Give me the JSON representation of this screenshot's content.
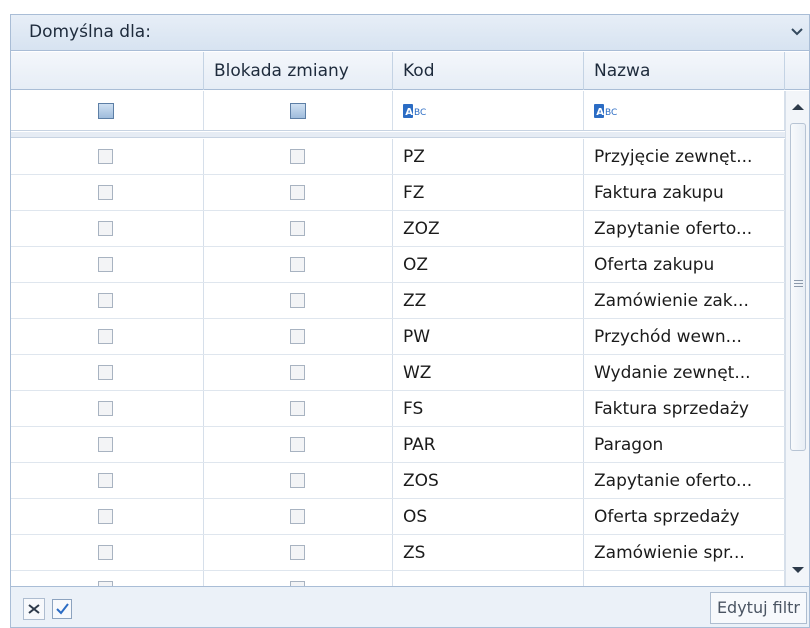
{
  "group": {
    "title": "Domyślna dla:"
  },
  "columns": {
    "col0": "",
    "col1": "Blokada zmiany",
    "col2": "Kod",
    "col3": "Nazwa"
  },
  "rows": [
    {
      "kod": "PZ",
      "nazwa": "Przyjęcie zewnęt..."
    },
    {
      "kod": "FZ",
      "nazwa": "Faktura zakupu"
    },
    {
      "kod": "ZOZ",
      "nazwa": "Zapytanie oferto..."
    },
    {
      "kod": "OZ",
      "nazwa": "Oferta zakupu"
    },
    {
      "kod": "ZZ",
      "nazwa": "Zamówienie zak..."
    },
    {
      "kod": "PW",
      "nazwa": "Przychód wewn..."
    },
    {
      "kod": "WZ",
      "nazwa": "Wydanie zewnęt..."
    },
    {
      "kod": "FS",
      "nazwa": "Faktura sprzedaży"
    },
    {
      "kod": "PAR",
      "nazwa": "Paragon"
    },
    {
      "kod": "ZOS",
      "nazwa": "Zapytanie oferto..."
    },
    {
      "kod": "OS",
      "nazwa": "Oferta sprzedaży"
    },
    {
      "kod": "ZS",
      "nazwa": "Zamówienie spr..."
    },
    {
      "kod": "",
      "nazwa": ""
    }
  ],
  "footer": {
    "edit_filter_label": "Edytuj filtr"
  },
  "colors": {
    "border": "#a9bdd6",
    "header_bg": "#e6edf6",
    "abc_icon": "#2b6cc4"
  }
}
